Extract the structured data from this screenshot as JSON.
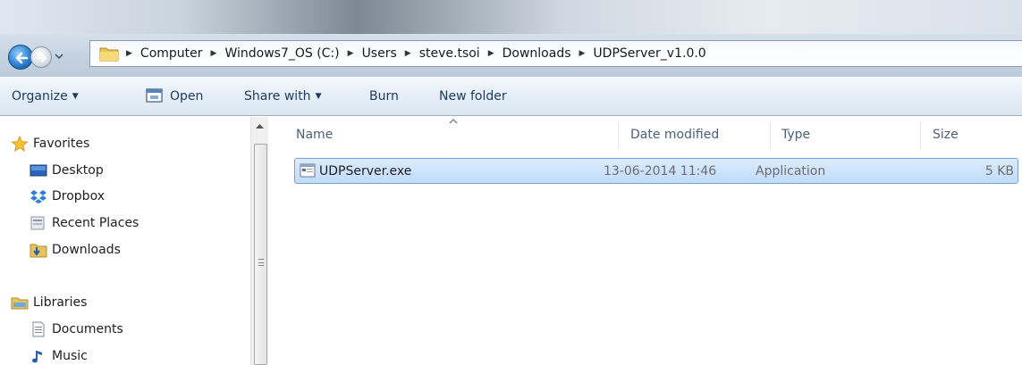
{
  "address_bar": {
    "breadcrumbs": [
      "Computer",
      "Windows7_OS (C:)",
      "Users",
      "steve.tsoi",
      "Downloads",
      "UDPServer_v1.0.0"
    ]
  },
  "toolbar": {
    "organize_label": "Organize",
    "open_label": "Open",
    "share_label": "Share with",
    "burn_label": "Burn",
    "new_folder_label": "New folder"
  },
  "nav_pane": {
    "favorites_label": "Favorites",
    "favorites": [
      "Desktop",
      "Dropbox",
      "Recent Places",
      "Downloads"
    ],
    "libraries_label": "Libraries",
    "libraries": [
      "Documents",
      "Music"
    ]
  },
  "file_list": {
    "columns": [
      "Name",
      "Date modified",
      "Type",
      "Size"
    ],
    "sorted_by": "Name",
    "rows": [
      {
        "name": "UDPServer.exe",
        "date_modified": "13-06-2014 11:46",
        "type": "Application",
        "size": "5 KB",
        "selected": true
      }
    ]
  },
  "colors": {
    "selection_fill": "#c1dcfc",
    "selection_border": "#7da2ce",
    "toolbar_text": "#1e395b",
    "header_text": "#4c607a"
  },
  "icons": {
    "back": "back-arrow-icon",
    "forward": "forward-arrow-icon",
    "favorites": "star-icon",
    "desktop": "desktop-icon",
    "dropbox": "dropbox-icon",
    "recent_places": "recent-places-icon",
    "downloads": "downloads-folder-icon",
    "libraries": "library-icon",
    "documents": "document-icon",
    "music": "music-note-icon",
    "file": "application-exe-icon"
  }
}
